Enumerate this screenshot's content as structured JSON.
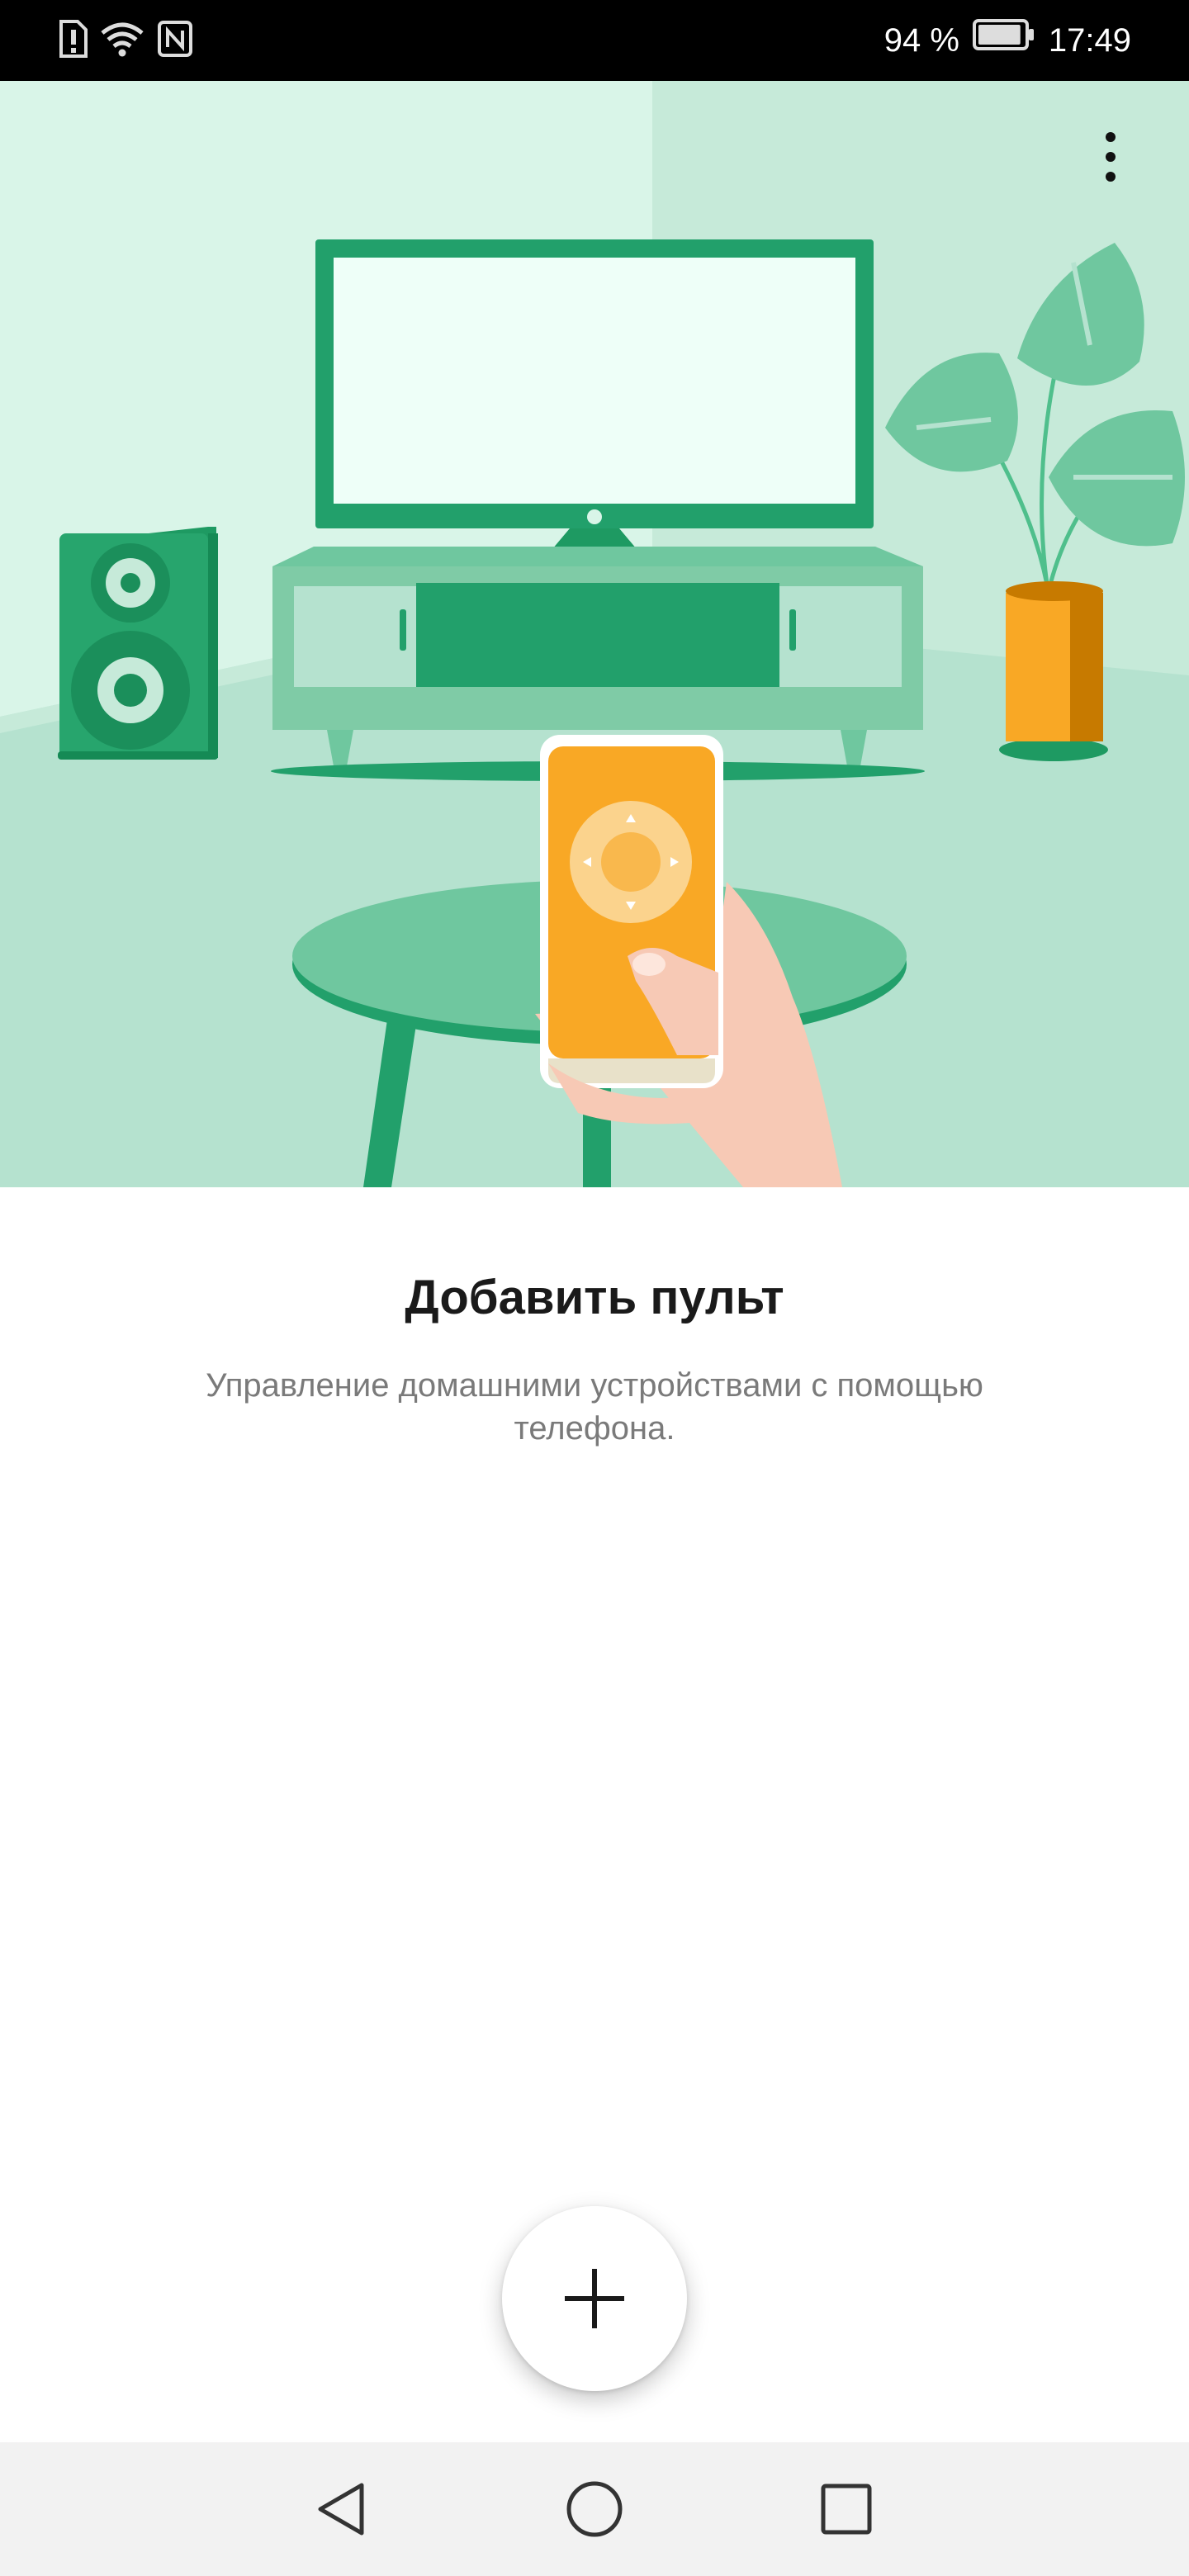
{
  "status_bar": {
    "battery_percent": "94 %",
    "time": "17:49",
    "icons": [
      "sim-alert-icon",
      "wifi-icon",
      "nfc-icon",
      "battery-icon"
    ],
    "battery_level": 0.94
  },
  "hero": {
    "illustration": "living-room-remote-illustration",
    "menu_icon": "more-vertical-icon"
  },
  "content": {
    "title": "Добавить пульт",
    "subtitle": "Управление домашними устройствами с помощью телефона."
  },
  "fab": {
    "icon": "plus-icon"
  },
  "nav_bar": {
    "buttons": [
      "back-icon",
      "home-icon",
      "recents-icon"
    ]
  },
  "colors": {
    "primary_green": "#22a06b",
    "light_green": "#b5e2cf",
    "accent_orange": "#f9a825",
    "skin": "#f7c9b5"
  }
}
